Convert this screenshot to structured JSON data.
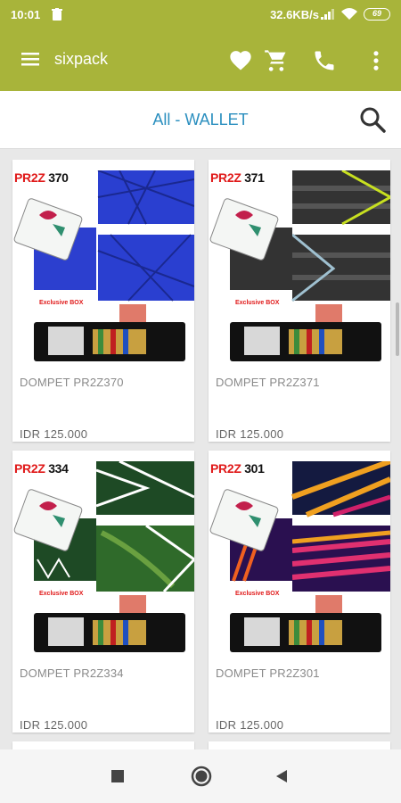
{
  "status_bar": {
    "time": "10:01",
    "net_speed": "32.6KB/s",
    "battery": "69"
  },
  "app_bar": {
    "title": "sixpack"
  },
  "filter": {
    "title": "All - WALLET"
  },
  "products": [
    {
      "code_brand": "PR2Z",
      "code_num": "370",
      "name": "DOMPET PR2Z370",
      "price": "IDR 125.000",
      "pattern": "blue-mosaic"
    },
    {
      "code_brand": "PR2Z",
      "code_num": "371",
      "name": "DOMPET PR2Z371",
      "price": "IDR 125.000",
      "pattern": "dark-stripes"
    },
    {
      "code_brand": "PR2Z",
      "code_num": "334",
      "name": "DOMPET PR2Z334",
      "price": "IDR 125.000",
      "pattern": "green-leaves"
    },
    {
      "code_brand": "PR2Z",
      "code_num": "301",
      "name": "DOMPET PR2Z301",
      "price": "IDR 125.000",
      "pattern": "neon-stripes"
    }
  ],
  "colors": {
    "primary": "#a8b43a",
    "accent_text": "#2b8fbf"
  }
}
